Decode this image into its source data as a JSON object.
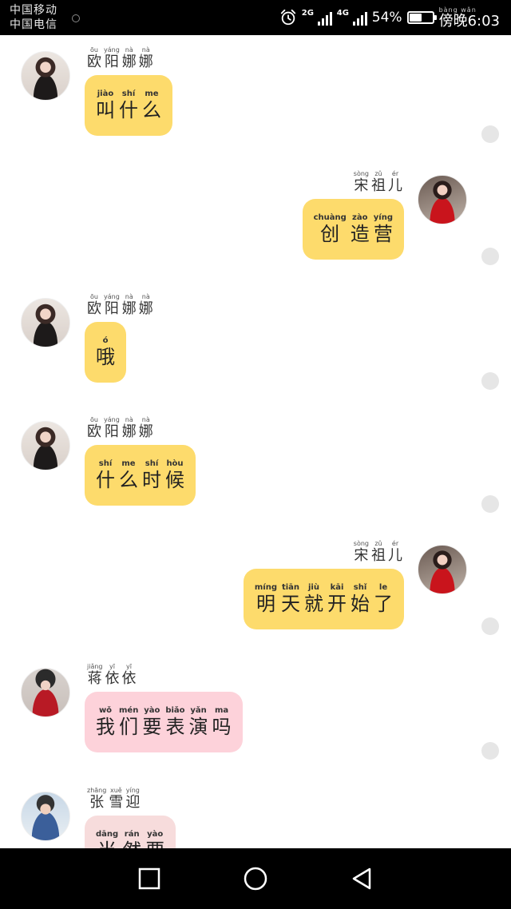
{
  "colors": {
    "yellow_bubble": "#fddb6c",
    "pink_bubble": "#fdd2da",
    "rose_bubble": "#f7dcdc",
    "status_dot": "#e6e6e6"
  },
  "status_bar": {
    "carrier_1": "中国移动",
    "carrier_2": "中国电信",
    "alarm_icon": "alarm-clock-icon",
    "network_1": "2G",
    "network_2": "4G",
    "battery_percent": "54%",
    "battery_level": 0.54,
    "clock_ruby": "bàng wǎn",
    "clock": "傍晚6:03"
  },
  "messages": [
    {
      "side": "left",
      "avatar": "avatar-a",
      "sender": [
        {
          "py": "ōu",
          "hz": "欧"
        },
        {
          "py": "yáng",
          "hz": "阳"
        },
        {
          "py": "nà",
          "hz": "娜"
        },
        {
          "py": "nà",
          "hz": "娜"
        }
      ],
      "text": [
        {
          "py": "jiào",
          "hz": "叫"
        },
        {
          "py": "shí",
          "hz": "什"
        },
        {
          "py": "me",
          "hz": "么"
        }
      ],
      "bubble_color": "#fddb6c"
    },
    {
      "side": "right",
      "avatar": "avatar-b",
      "sender": [
        {
          "py": "sòng",
          "hz": "宋"
        },
        {
          "py": "zǔ",
          "hz": "祖"
        },
        {
          "py": "ér",
          "hz": "儿"
        }
      ],
      "text": [
        {
          "py": "chuàng",
          "hz": "创"
        },
        {
          "py": "zào",
          "hz": "造"
        },
        {
          "py": "yíng",
          "hz": "营"
        }
      ],
      "bubble_color": "#fddb6c"
    },
    {
      "side": "left",
      "avatar": "avatar-a",
      "sender": [
        {
          "py": "ōu",
          "hz": "欧"
        },
        {
          "py": "yáng",
          "hz": "阳"
        },
        {
          "py": "nà",
          "hz": "娜"
        },
        {
          "py": "nà",
          "hz": "娜"
        }
      ],
      "text": [
        {
          "py": "ó",
          "hz": "哦"
        }
      ],
      "bubble_color": "#fddb6c"
    },
    {
      "side": "left",
      "avatar": "avatar-a",
      "sender": [
        {
          "py": "ōu",
          "hz": "欧"
        },
        {
          "py": "yáng",
          "hz": "阳"
        },
        {
          "py": "nà",
          "hz": "娜"
        },
        {
          "py": "nà",
          "hz": "娜"
        }
      ],
      "text": [
        {
          "py": "shí",
          "hz": "什"
        },
        {
          "py": "me",
          "hz": "么"
        },
        {
          "py": "shí",
          "hz": "时"
        },
        {
          "py": "hòu",
          "hz": "候"
        }
      ],
      "bubble_color": "#fddb6c"
    },
    {
      "side": "right",
      "avatar": "avatar-b",
      "sender": [
        {
          "py": "sòng",
          "hz": "宋"
        },
        {
          "py": "zǔ",
          "hz": "祖"
        },
        {
          "py": "ér",
          "hz": "儿"
        }
      ],
      "text": [
        {
          "py": "míng",
          "hz": "明"
        },
        {
          "py": "tiān",
          "hz": "天"
        },
        {
          "py": "jiù",
          "hz": "就"
        },
        {
          "py": "kāi",
          "hz": "开"
        },
        {
          "py": "shǐ",
          "hz": "始"
        },
        {
          "py": "le",
          "hz": "了"
        }
      ],
      "bubble_color": "#fddb6c"
    },
    {
      "side": "left",
      "avatar": "avatar-c",
      "sender": [
        {
          "py": "jiǎng",
          "hz": "蒋"
        },
        {
          "py": "yī",
          "hz": "依"
        },
        {
          "py": "yī",
          "hz": "依"
        }
      ],
      "text": [
        {
          "py": "wǒ",
          "hz": "我"
        },
        {
          "py": "mén",
          "hz": "们"
        },
        {
          "py": "yào",
          "hz": "要"
        },
        {
          "py": "biǎo",
          "hz": "表"
        },
        {
          "py": "yǎn",
          "hz": "演"
        },
        {
          "py": "ma",
          "hz": "吗"
        }
      ],
      "bubble_color": "#fdd2da"
    },
    {
      "side": "left",
      "avatar": "avatar-d",
      "sender": [
        {
          "py": "zhāng",
          "hz": "张"
        },
        {
          "py": "xuě",
          "hz": "雪"
        },
        {
          "py": "yíng",
          "hz": "迎"
        }
      ],
      "text": [
        {
          "py": "dāng",
          "hz": "当"
        },
        {
          "py": "rán",
          "hz": "然"
        },
        {
          "py": "yào",
          "hz": "要"
        }
      ],
      "bubble_color": "#f7dcdc"
    }
  ],
  "nav_bar": {
    "recents_icon": "square-recents-icon",
    "home_icon": "circle-home-icon",
    "back_icon": "triangle-back-icon"
  }
}
